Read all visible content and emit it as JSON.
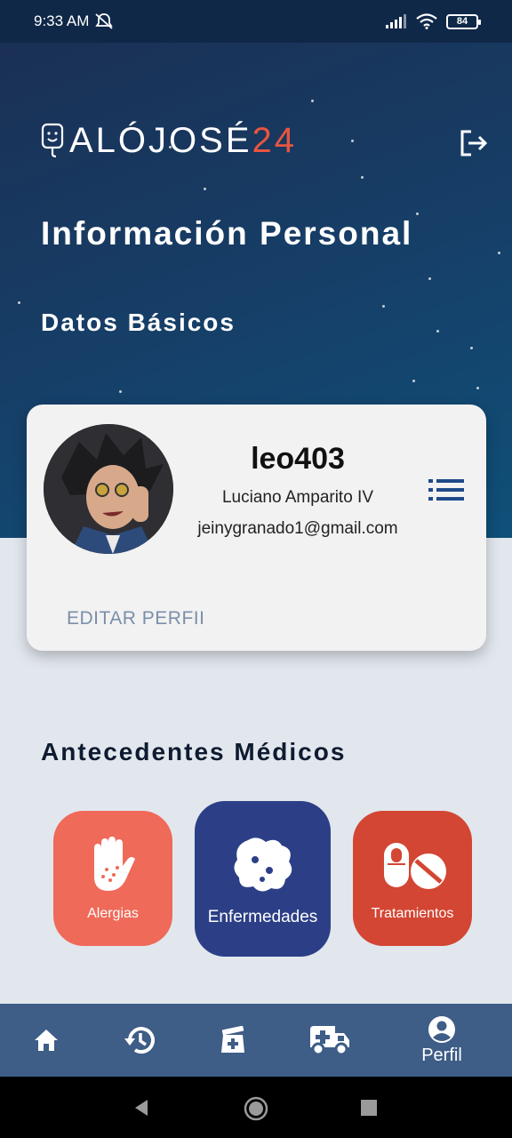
{
  "status_bar": {
    "time": "9:33 AM",
    "battery": "84",
    "icons": [
      "mute-icon",
      "signal-icon",
      "wifi-icon",
      "battery-icon"
    ]
  },
  "header": {
    "logo_prefix": "ALÓJOSÉ",
    "logo_suffix": "24",
    "title": "Información Personal",
    "section_basic": "Datos Básicos"
  },
  "profile": {
    "username": "leo403",
    "full_name": "Luciano Amparito IV",
    "email": "jeinygranado1@gmail.com",
    "edit_label": "EDITAR PERFII"
  },
  "medical": {
    "section_title": "Antecedentes Médicos",
    "tiles": [
      {
        "label": "Alergias",
        "icon": "hand-icon",
        "color": "#ef6a59"
      },
      {
        "label": "Enfermedades",
        "icon": "virus-icon",
        "color": "#2c3f86"
      },
      {
        "label": "Tratamientos",
        "icon": "pills-icon",
        "color": "#d34633"
      }
    ]
  },
  "bottom_nav": {
    "items": [
      {
        "icon": "home-icon"
      },
      {
        "icon": "history-icon"
      },
      {
        "icon": "medical-kit-icon"
      },
      {
        "icon": "ambulance-icon"
      },
      {
        "icon": "account-icon",
        "label": "Perfil",
        "active": true
      }
    ]
  },
  "colors": {
    "brand_accent": "#e8553f",
    "nav_background": "#3e5d87",
    "hero_dark": "#1b2e52"
  }
}
